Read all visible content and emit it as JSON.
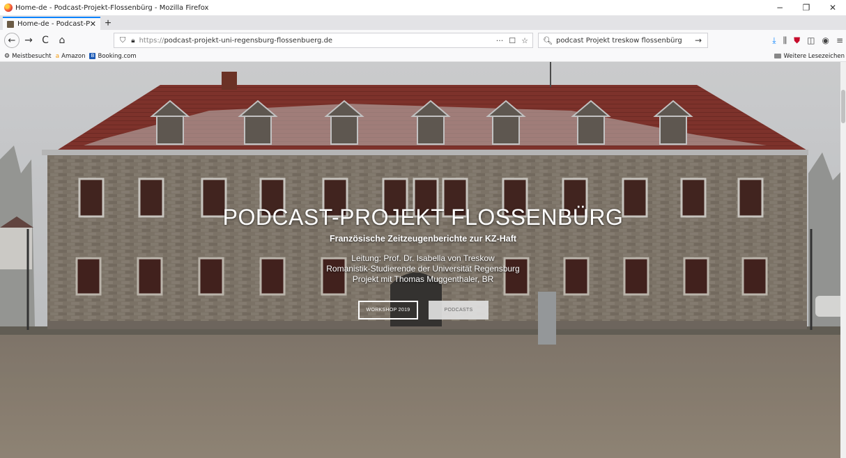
{
  "window": {
    "title": "Home-de - Podcast-Projekt-Flossenbürg - Mozilla Firefox",
    "controls": {
      "minimize": "−",
      "restore": "❐",
      "close": "✕"
    }
  },
  "tabs": [
    {
      "title": "Home-de - Podcast-Projekt",
      "close": "✕"
    }
  ],
  "new_tab": "+",
  "nav": {
    "back": "←",
    "forward": "→",
    "reload": "C",
    "home": "⌂",
    "url_protocol": "https://",
    "url_host": "podcast-projekt-uni-regensburg-flossenbuerg.de",
    "url_actions": [
      "···",
      "☐",
      "☆"
    ],
    "search_value": "podcast Projekt treskow flossenbürg",
    "search_go": "→"
  },
  "toolbar_icons": [
    "download-icon",
    "library-icon",
    "ublock-icon",
    "sidebar-icon",
    "extension-icon",
    "menu-icon"
  ],
  "bookmarks": {
    "items": [
      {
        "label": "Meistbesucht",
        "icon": "gear-icon"
      },
      {
        "label": "Amazon",
        "icon": "amazon-icon"
      },
      {
        "label": "Booking.com",
        "icon": "booking-icon"
      }
    ],
    "other": "Weitere Lesezeichen"
  },
  "hero": {
    "title": "PODCAST-PROJEKT FLOSSENBÜRG",
    "subtitle": "Französische Zeitzeugenberichte zur KZ-Haft",
    "lines": [
      "Leitung: Prof. Dr. Isabella von Treskow",
      "Romanistik-Studierende der Universität Regensburg",
      "Projekt mit Thomas Muggenthaler, BR"
    ],
    "buttons": {
      "workshop": "WORKSHOP 2019",
      "podcasts": "PODCASTS"
    }
  },
  "colors": {
    "accent": "#0a84ff",
    "roof": "#8f3a31",
    "stone": "#8c8275"
  }
}
